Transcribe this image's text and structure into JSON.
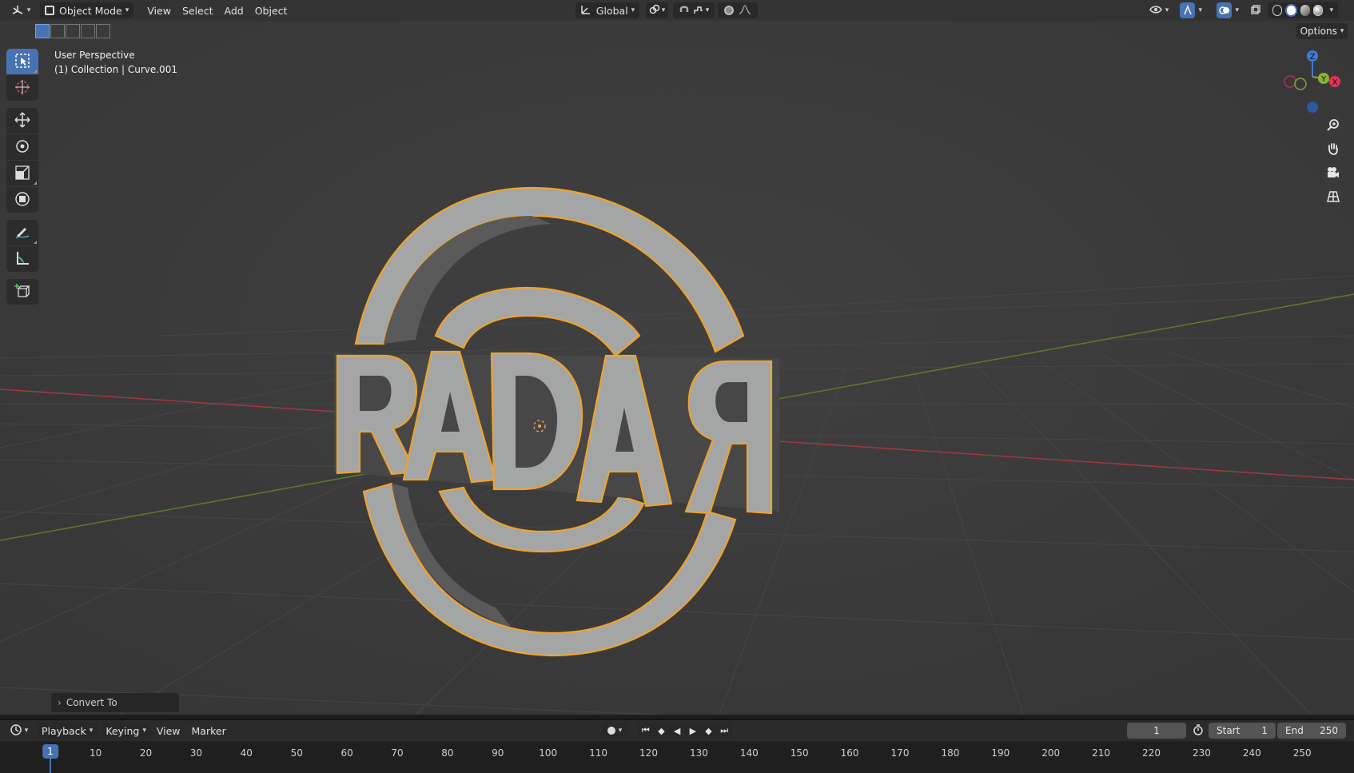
{
  "header": {
    "mode": "Object Mode",
    "menus": [
      "View",
      "Select",
      "Add",
      "Object"
    ],
    "transform_orientation": "Global",
    "options_label": "Options"
  },
  "viewport": {
    "view_name": "User Perspective",
    "collection_path": "(1) Collection | Curve.001",
    "object_text": "RADAR",
    "outline_color": "#f0a22a",
    "axis_x_color": "#c0414a",
    "axis_y_color": "#6b8e2e"
  },
  "gizmo": {
    "x_label": "X",
    "y_label": "Y",
    "z_label": "Z"
  },
  "operator_panel": {
    "label": "Convert To"
  },
  "timeline": {
    "menus": [
      "Playback",
      "Keying",
      "View",
      "Marker"
    ],
    "current_frame": "1",
    "start_label": "Start",
    "start_value": "1",
    "end_label": "End",
    "end_value": "250",
    "ruler_current": "1",
    "ruler_ticks": [
      "10",
      "20",
      "30",
      "40",
      "50",
      "60",
      "70",
      "80",
      "90",
      "100",
      "110",
      "120",
      "130",
      "140",
      "150",
      "160",
      "170",
      "180",
      "190",
      "200",
      "210",
      "220",
      "230",
      "240",
      "250"
    ]
  },
  "colors": {
    "accent": "#4772b3",
    "viewport_bg": "#3b3b3b",
    "header_bg": "#303030"
  }
}
